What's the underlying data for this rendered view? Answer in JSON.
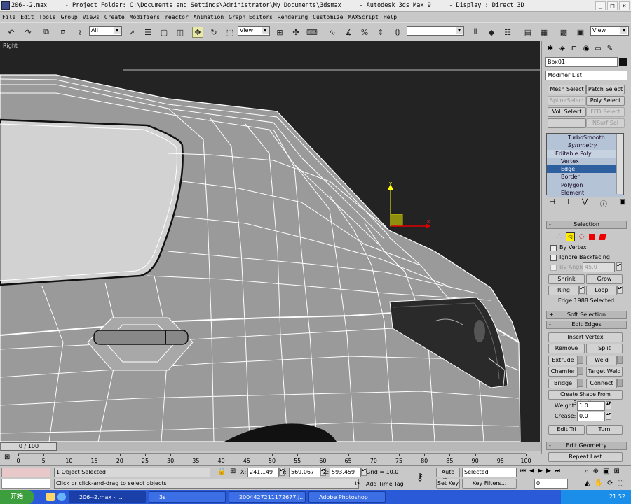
{
  "titlebar": {
    "text": "206--2.max     - Project Folder: C:\\Documents and Settings\\Administrator\\My Documents\\3dsmax     - Autodesk 3ds Max 9     - Display : Direct 3D"
  },
  "menu": [
    "File",
    "Edit",
    "Tools",
    "Group",
    "Views",
    "Create",
    "Modifiers",
    "reactor",
    "Animation",
    "Graph Editors",
    "Rendering",
    "Customize",
    "MAXScript",
    "Help"
  ],
  "toolbar": {
    "selection_filter": "All",
    "ref_coord": "View",
    "named_sel": "",
    "view_right": "View"
  },
  "viewport": {
    "label": "Right",
    "gizmo_x": "x",
    "gizmo_y": "y"
  },
  "panel": {
    "object_name": "Box01",
    "modifier_list": "Modifier List",
    "buttons": {
      "mesh_select": "Mesh Select",
      "patch_select": "Patch Select",
      "spline_select": "SplineSelect",
      "poly_select": "Poly Select",
      "vol_select": "Vol. Select",
      "ffd_select": "FFD Select",
      "nsurf_sel": "NSurf Sel"
    },
    "stack": [
      "TurboSmooth",
      "Symmetry",
      "Editable Poly",
      "Vertex",
      "Edge",
      "Border",
      "Polygon",
      "Element"
    ],
    "selection": {
      "title": "Selection",
      "by_vertex": "By Vertex",
      "ignore_backfacing": "Ignore Backfacing",
      "by_angle": "By Angle:",
      "angle_value": "45.0",
      "shrink": "Shrink",
      "grow": "Grow",
      "ring": "Ring",
      "loop": "Loop",
      "status": "Edge 1988 Selected"
    },
    "soft_selection": "Soft Selection",
    "edit_edges": {
      "title": "Edit Edges",
      "insert_vertex": "Insert Vertex",
      "remove": "Remove",
      "split": "Split",
      "extrude": "Extrude",
      "weld": "Weld",
      "chamfer": "Chamfer",
      "target_weld": "Target Weld",
      "bridge": "Bridge",
      "connect": "Connect",
      "create_shape": "Create Shape From Selection",
      "weight_label": "Weight:",
      "weight_value": "1.0",
      "crease_label": "Crease:",
      "crease_value": "0.0",
      "edit_tri": "Edit Tri",
      "turn": "Turn"
    },
    "edit_geometry": {
      "title": "Edit Geometry",
      "repeat_last": "Repeat Last"
    }
  },
  "timeline": {
    "frame": "0 / 100",
    "ticks": [
      "0",
      "5",
      "10",
      "15",
      "20",
      "25",
      "30",
      "35",
      "40",
      "45",
      "50",
      "55",
      "60",
      "65",
      "70",
      "75",
      "80",
      "85",
      "90",
      "95",
      "100"
    ]
  },
  "status": {
    "selected": "1 Object Selected",
    "prompt": "Click or click-and-drag to select objects",
    "x_label": "X:",
    "x": "241.149",
    "y_label": "Y:",
    "y": "569.067",
    "z_label": "Z:",
    "z": "593.459",
    "grid": "Grid = 10.0",
    "add_time_tag": "Add Time Tag",
    "auto_key": "Auto Key",
    "set_key": "Set Key",
    "key_mode": "Selected",
    "key_filters": "Key Filters...",
    "frame_field": "0"
  },
  "taskbar": {
    "start": "开始",
    "tasks": [
      "206--2.max - ...",
      "3s",
      "2004427211172677.j...",
      "Adobe Photoshop"
    ],
    "clock": "21:52"
  }
}
